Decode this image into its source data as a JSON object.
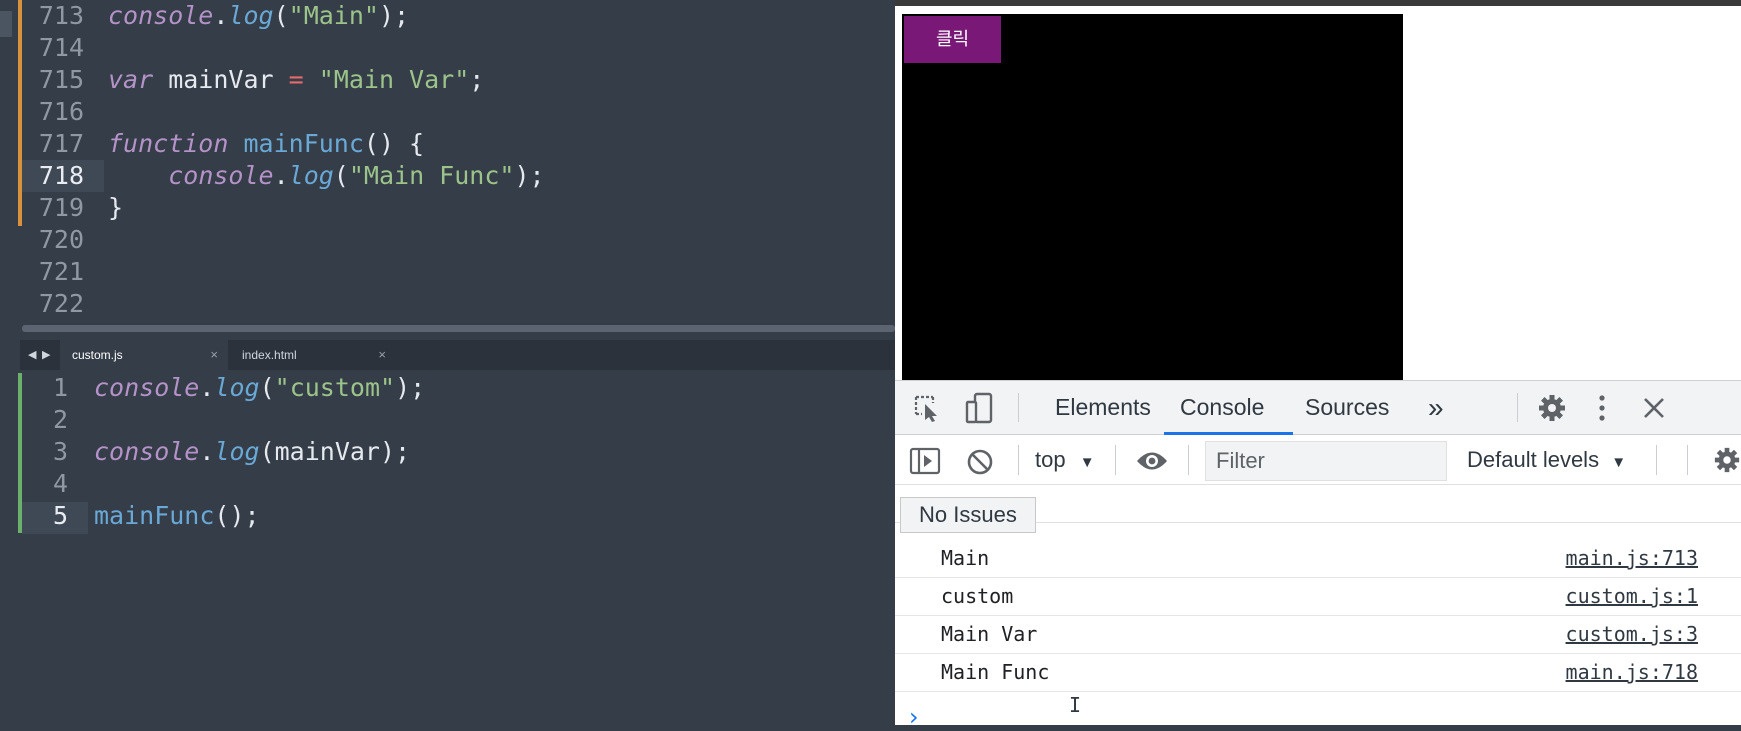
{
  "editor_top": {
    "lines": [
      {
        "num": "713",
        "parts": [
          [
            "obj",
            "console"
          ],
          [
            "plain",
            "."
          ],
          [
            "fn",
            "log"
          ],
          [
            "plain",
            "("
          ],
          [
            "str",
            "\"Main\""
          ],
          [
            "plain",
            ");"
          ]
        ]
      },
      {
        "num": "714",
        "parts": []
      },
      {
        "num": "715",
        "parts": [
          [
            "kw",
            "var"
          ],
          [
            "plain",
            " mainVar "
          ],
          [
            "op",
            "="
          ],
          [
            "plain",
            " "
          ],
          [
            "str",
            "\"Main Var\""
          ],
          [
            "plain",
            ";"
          ]
        ]
      },
      {
        "num": "716",
        "parts": []
      },
      {
        "num": "717",
        "parts": [
          [
            "kw",
            "function"
          ],
          [
            "plain",
            " "
          ],
          [
            "call",
            "mainFunc"
          ],
          [
            "plain",
            "() {"
          ]
        ]
      },
      {
        "num": "718",
        "parts": [
          [
            "plain",
            "    "
          ],
          [
            "obj",
            "console"
          ],
          [
            "plain",
            "."
          ],
          [
            "fn",
            "log"
          ],
          [
            "plain",
            "("
          ],
          [
            "str",
            "\"Main Func\""
          ],
          [
            "plain",
            ");"
          ]
        ]
      },
      {
        "num": "719",
        "parts": [
          [
            "plain",
            "}"
          ]
        ]
      },
      {
        "num": "720",
        "parts": []
      },
      {
        "num": "721",
        "parts": []
      },
      {
        "num": "722",
        "parts": []
      }
    ]
  },
  "tabs": [
    {
      "label": "custom.js",
      "close": "×"
    },
    {
      "label": "index.html",
      "close": "×"
    }
  ],
  "editor_bottom": {
    "lines": [
      {
        "num": "1",
        "parts": [
          [
            "obj",
            "console"
          ],
          [
            "plain",
            "."
          ],
          [
            "fn",
            "log"
          ],
          [
            "plain",
            "("
          ],
          [
            "str",
            "\"custom\""
          ],
          [
            "plain",
            ");"
          ]
        ]
      },
      {
        "num": "2",
        "parts": []
      },
      {
        "num": "3",
        "parts": [
          [
            "obj",
            "console"
          ],
          [
            "plain",
            "."
          ],
          [
            "fn",
            "log"
          ],
          [
            "plain",
            "(mainVar);"
          ]
        ]
      },
      {
        "num": "4",
        "parts": []
      },
      {
        "num": "5",
        "parts": [
          [
            "call",
            "mainFunc"
          ],
          [
            "plain",
            "();"
          ]
        ]
      }
    ]
  },
  "page": {
    "button_label": "클릭"
  },
  "devtools": {
    "tabs": [
      "Elements",
      "Console",
      "Sources"
    ],
    "more": "»",
    "context": "top",
    "filter_placeholder": "Filter",
    "levels": "Default levels",
    "issues": "No Issues",
    "rows": [
      {
        "msg": "Main",
        "src": "main.js:713"
      },
      {
        "msg": "custom",
        "src": "custom.js:1"
      },
      {
        "msg": "Main Var",
        "src": "custom.js:3"
      },
      {
        "msg": "Main Func",
        "src": "main.js:718"
      }
    ],
    "prompt": "›"
  },
  "colors": {
    "editor_bg": "#343d48",
    "page_button": "#7a1878",
    "devtools_accent": "#1a73e8"
  }
}
